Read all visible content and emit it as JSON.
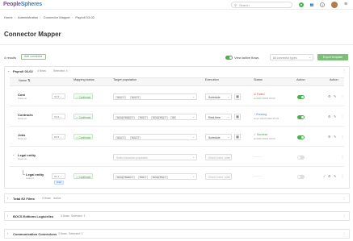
{
  "topbar": {
    "logo_part1": "People",
    "logo_part2": "Spheres",
    "search_placeholder": "Search"
  },
  "breadcrumb": [
    "Home",
    "Administration",
    "Connector Mapper",
    "Payroll 03-02"
  ],
  "page_title": "Connector Mapper",
  "toolbar": {
    "label": "4 results",
    "add_connector": "Add connector",
    "view_active_flows": "View active flows",
    "filter_value": "All connector types",
    "export_label": "Export template"
  },
  "panels": [
    {
      "name": "Payroll 03-02",
      "meta1": "4 flows",
      "meta2": "Selected: 4",
      "expanded": true
    },
    {
      "name": "Total E2 Films",
      "meta1": "3 flows",
      "meta2": "Active"
    },
    {
      "name": "BOCS Editions Logicielles",
      "meta1": "3 flows",
      "meta2": "Selected: 1"
    },
    {
      "name": "Communication Connexions",
      "meta1": "3 flows",
      "meta2": "Selected: 1"
    }
  ],
  "columns": {
    "name": "Name",
    "mapping_status": "Mapping status",
    "target_population": "Target population",
    "execution": "Execution",
    "status": "Status",
    "action": "Action",
    "action2": "Action"
  },
  "rows": [
    {
      "name": "Cost",
      "sub": "Data set",
      "ver": "V1.5",
      "mapping": "Confirmed",
      "tags": [
        "Grex",
        "Grex"
      ],
      "exec": "Schedule",
      "status": "Failed",
      "status_sub": "at 03/07/2022 09:22",
      "status_color": "#d9534f",
      "toggle": "on"
    },
    {
      "name": "Contracts",
      "sub": "Data set",
      "ver": "V1.5",
      "mapping": "Confirmed",
      "tags": [
        "Group Status",
        "Tole",
        "Group Pay",
        "All"
      ],
      "exec": "Real-time",
      "status": "Running",
      "status_sub": "since 03/07/2022 09:22",
      "status_color": "#3c7fd0",
      "toggle": "on"
    },
    {
      "name": "Jobs",
      "sub": "Data set",
      "ver": "V1.5",
      "mapping": "Confirmed",
      "tags": [
        "Grex",
        "Grex"
      ],
      "exec": "Schedule",
      "status": "Success",
      "status_sub": "at 03/07/2022 09:22",
      "status_color": "#4a9b48",
      "toggle": "on"
    },
    {
      "name": "Legal entity",
      "sub": "Data set",
      "pop_placeholder": "Select execution population",
      "exec": "Select exec. plan",
      "status": "———",
      "toggle": "off"
    },
    {
      "name": "Legal entity",
      "sub": "Listrent",
      "ver": "V1.1",
      "draft": "Draft",
      "mapping": "Confirmed",
      "tags": [
        "Group Status",
        "Tole",
        "Group Pay"
      ],
      "exec": "Select exec. plan",
      "status": "———",
      "toggle": "off"
    }
  ]
}
